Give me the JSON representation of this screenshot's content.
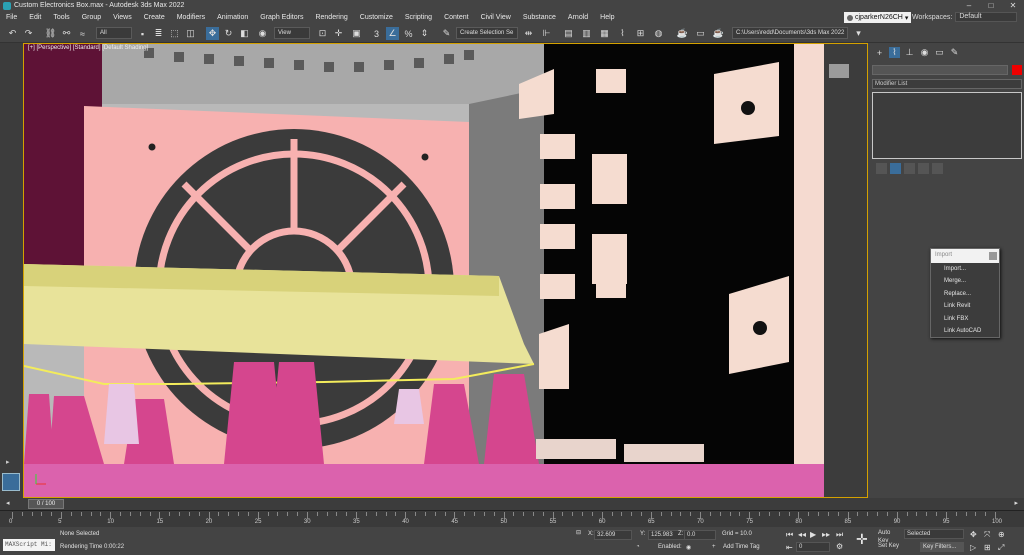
{
  "window": {
    "title": "Custom Electronics Box.max - Autodesk 3ds Max 2022"
  },
  "menu": [
    "File",
    "Edit",
    "Tools",
    "Group",
    "Views",
    "Create",
    "Modifiers",
    "Animation",
    "Graph Editors",
    "Rendering",
    "Customize",
    "Scripting",
    "Content",
    "Civil View",
    "Substance",
    "Arnold",
    "Help"
  ],
  "user": {
    "name": "cjparkerN26CH"
  },
  "workspaces": {
    "label": "Workspaces:",
    "value": "Default"
  },
  "toolbar": {
    "filter": "All",
    "ref_coord": "View",
    "selection_set": "Create Selection Se",
    "project_path": "C:\\Users\\redd\\Documents\\3ds Max 2022"
  },
  "viewport": {
    "label": "[+] [Perspective] [Standard] [Default Shading]"
  },
  "command_panel": {
    "modifier_list": "Modifier List"
  },
  "import_menu": {
    "title": "Import",
    "items": [
      "Import...",
      "Merge...",
      "Replace...",
      "Link Revit",
      "Link FBX",
      "Link AutoCAD"
    ]
  },
  "time": {
    "slider": "0 / 100",
    "ticks": [
      "0",
      "5",
      "10",
      "15",
      "20",
      "25",
      "30",
      "35",
      "40",
      "45",
      "50",
      "55",
      "60",
      "65",
      "70",
      "75",
      "80",
      "85",
      "90",
      "95",
      "100"
    ]
  },
  "status": {
    "maxscript": "MAXScript Mi:",
    "selection": "None Selected",
    "render_time": "Rendering Time  0:00:22",
    "x_label": "X:",
    "x_val": "32.609",
    "y_label": "Y:",
    "y_val": "125.983",
    "z_label": "Z:",
    "z_val": "0.0",
    "grid": "Grid = 10.0",
    "enabled": "Enabled:",
    "add_time_tag": "Add Time Tag",
    "auto_key": "Auto Key",
    "set_key": "Set Key",
    "selected": "Selected",
    "key_filters": "Key Filters...",
    "frame": "0"
  }
}
